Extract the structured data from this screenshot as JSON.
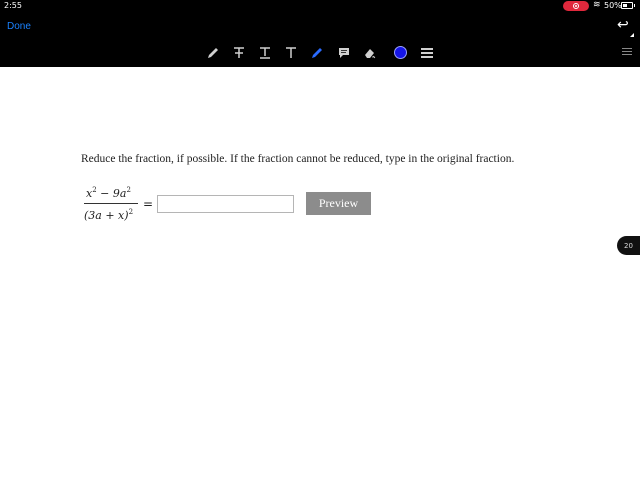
{
  "status_bar": {
    "time": "2:55",
    "battery_percent": "50%",
    "battery_level": 0.5
  },
  "nav": {
    "done_label": "Done"
  },
  "toolbar": {
    "tools": [
      {
        "name": "pen",
        "glyph": "✎"
      },
      {
        "name": "text-strike",
        "glyph": "T"
      },
      {
        "name": "text-underline",
        "glyph": "T"
      },
      {
        "name": "text-plain",
        "glyph": "T"
      },
      {
        "name": "highlighter",
        "glyph": "✎"
      },
      {
        "name": "comment",
        "glyph": "▪"
      },
      {
        "name": "eraser",
        "glyph": "⌫"
      }
    ],
    "current_color": "#1515e6"
  },
  "problem": {
    "instruction": "Reduce the fraction, if possible. If the fraction cannot be reduced, type in the original fraction.",
    "numerator_base": "x",
    "numerator_exp": "2",
    "numerator_minus": " − 9a",
    "numerator_exp2": "2",
    "denominator": "(3a + x)",
    "denominator_exp": "2",
    "equals": "=",
    "answer_value": "",
    "preview_label": "Preview"
  },
  "page_badge": "20",
  "colors": {
    "accent_done": "#1a82ff",
    "preview_bg": "#8c8c8c",
    "record_red": "#e0283c"
  }
}
